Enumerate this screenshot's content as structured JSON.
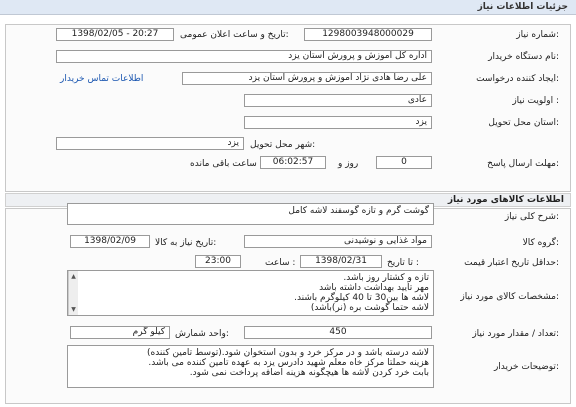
{
  "header": {
    "title": "جزئیات اطلاعات نیاز"
  },
  "need_info": {
    "need_number_label": "شماره نیاز:",
    "need_number": "1298003948000029",
    "announce_label": "تاریخ و ساعت اعلان عمومی:",
    "announce_value": "1398/02/05 - 20:27",
    "buyer_org_label": "نام دستگاه خریدار:",
    "buyer_org": "اداره کل آموزش و پرورش استان یزد",
    "creator_label": "ایجاد کننده درخواست:",
    "creator": "علی رضا هادی نژاد آموزش و پرورش استان یزد",
    "contact_link": "اطلاعات تماس خریدار",
    "priority_label": "اولویت نیاز :",
    "priority": "عادی",
    "province_label": "استان محل تحویل:",
    "province": "یزد",
    "city_label": "شهر محل تحویل:",
    "city": "یزد",
    "deadline_label": "مهلت ارسال پاسخ:",
    "deadline_days": "0",
    "day_label": "روز و",
    "deadline_time": "06:02:57",
    "remaining_label": "ساعت باقی مانده"
  },
  "goods_section": {
    "title": "اطلاعات کالاهای مورد نیاز"
  },
  "goods": {
    "summary_label": "شرح کلی نیاز:",
    "summary": "گوشت گرم و تازه گوسفند لاشه کامل",
    "group_label": "گروه کالا:",
    "group": "مواد غذایی و نوشیدنی",
    "need_date_label": "تاریخ نیاز به کالا:",
    "need_date": "1398/02/09",
    "validity_label": "حداقل تاریخ اعتبار قیمت:",
    "until_date_label": "تا تاریخ :",
    "until_date": "1398/02/31",
    "hour_label": "ساعت :",
    "hour": "23:00",
    "specs_label": "مشخصات کالای مورد نیاز:",
    "specs_lines": [
      "تازه و کشتار روز باشد.",
      "مهر تایید بهداشت داشته باشد",
      "لاشه ها بین30 تا 40 کیلوگرم باشند.",
      "لاشه حتما گوشت بره (نر)باشد)"
    ],
    "quantity_label": "تعداد / مقدار مورد نیاز:",
    "quantity": "450",
    "unit_label": "واحد شمارش:",
    "unit": "کیلو گرم",
    "buyer_notes_label": "توضیحات خریدار:",
    "buyer_notes_lines": [
      "لاشه درسته باشد و در مرکز خرد و بدون استخوان شود.(توسط تامین کننده)",
      "هزینه حملتا مرکز خاه معلم شهید دادرس یزد به عهده تامین کننده می باشد.",
      "بابت خرد کردن لاشه ها هیچگونه هزینه اضافه پرداخت نمی شود."
    ]
  }
}
